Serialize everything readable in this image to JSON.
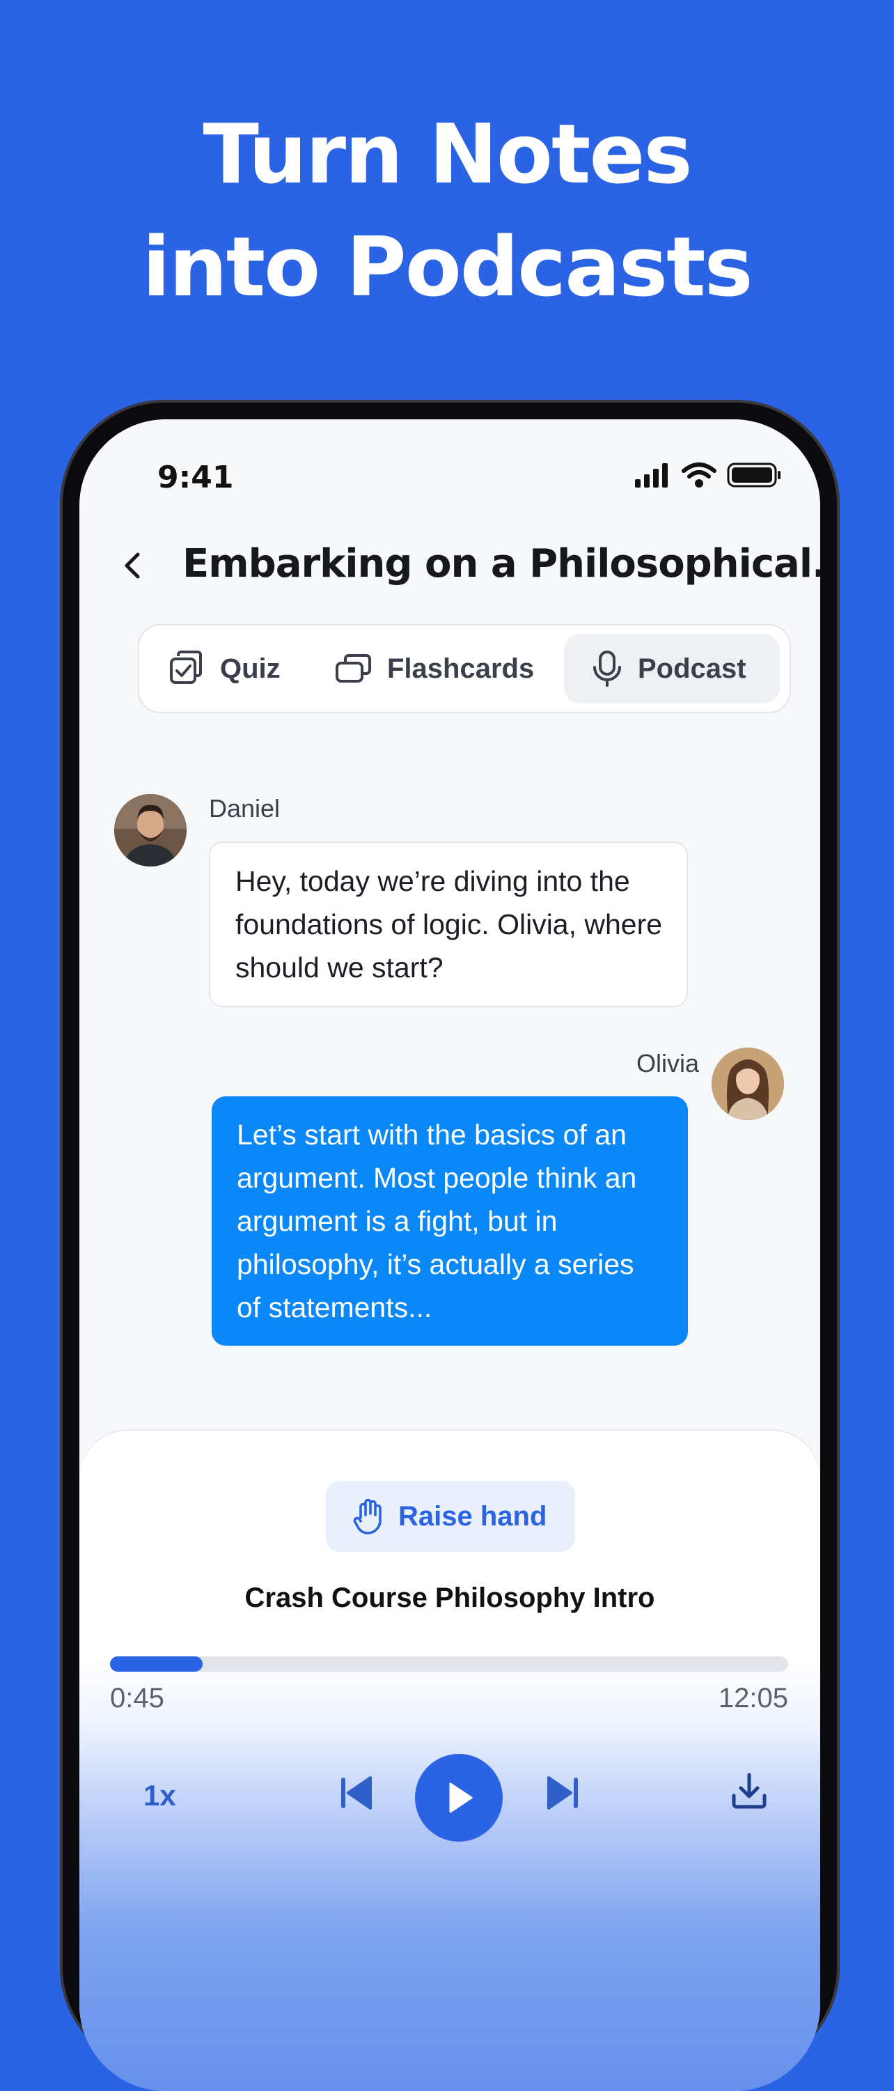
{
  "hero": {
    "line1": "Turn Notes",
    "line2": "into Podcasts"
  },
  "status_bar": {
    "time": "9:41"
  },
  "header": {
    "title": "Embarking on a Philosophical..."
  },
  "tabs": [
    {
      "label": "Quiz",
      "icon": "checkbox-icon"
    },
    {
      "label": "Flashcards",
      "icon": "cards-icon"
    },
    {
      "label": "Podcast",
      "icon": "microphone-icon",
      "selected": true
    }
  ],
  "chat": {
    "messages": [
      {
        "speaker": "Daniel",
        "text": "Hey, today we’re diving into the foundations of logic. Olivia, where should we start?"
      },
      {
        "speaker": "Olivia",
        "text": "Let’s start with the basics of an argument. Most people think an argument is a fight, but in philosophy, it’s actually a series of statements..."
      }
    ]
  },
  "player": {
    "raise_hand_label": "Raise hand",
    "episode_title": "Crash Course Philosophy Intro",
    "elapsed": "0:45",
    "total": "12:05",
    "progress": 0.062,
    "speed": "1x"
  },
  "colors": {
    "brand": "#2A63E4",
    "bubble_blue": "#0A88F8"
  }
}
